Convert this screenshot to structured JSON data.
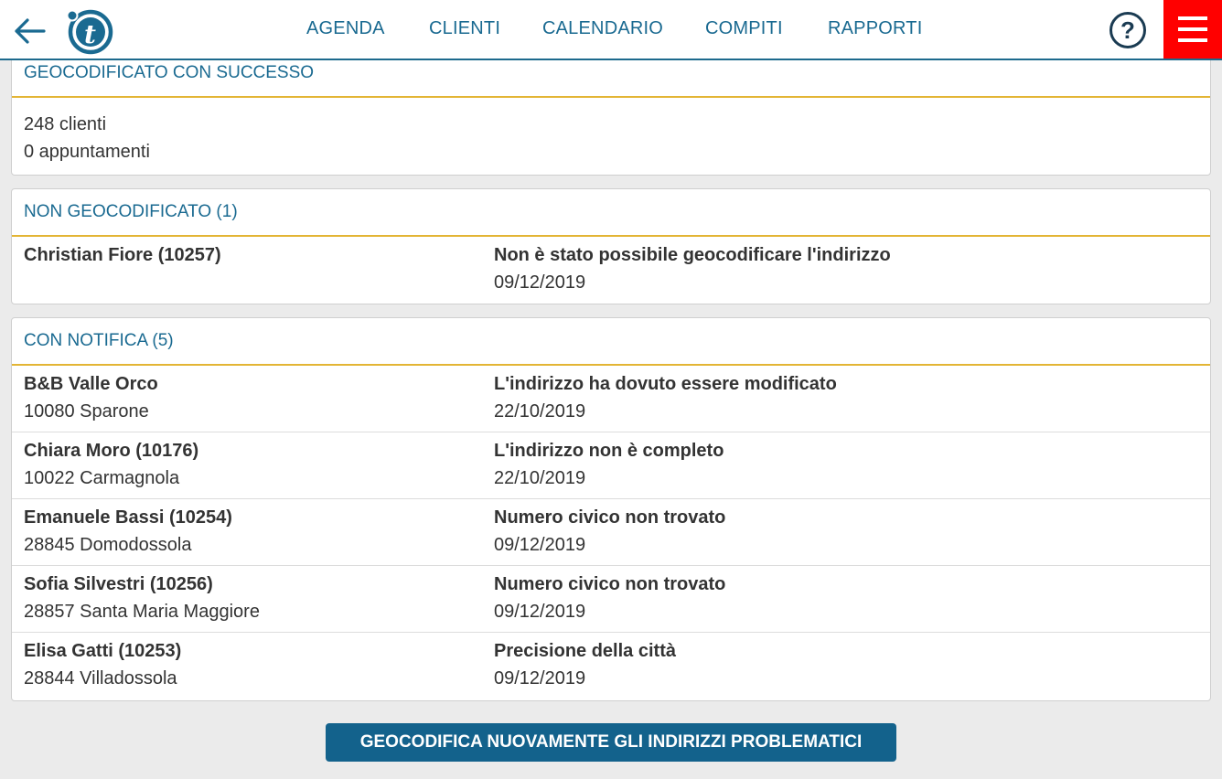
{
  "header": {
    "nav": [
      {
        "label": "AGENDA"
      },
      {
        "label": "CLIENTI"
      },
      {
        "label": "CALENDARIO"
      },
      {
        "label": "COMPITI"
      },
      {
        "label": "RAPPORTI"
      }
    ],
    "help_label": "?",
    "icons": {
      "back": "arrow-left-icon",
      "logo": "t-logo",
      "help": "question-mark-icon",
      "menu": "hamburger-menu-icon"
    }
  },
  "colors": {
    "accent": "#1a6a91",
    "menu_bg": "#ff0000",
    "divider": "#e3b535",
    "button": "#13628c"
  },
  "success": {
    "title": "GEOCODIFICATO CON SUCCESSO",
    "lines": [
      "248 clienti",
      "0 appuntamenti"
    ]
  },
  "failed": {
    "title": "NON GEOCODIFICATO (1)",
    "rows": [
      {
        "name": "Christian Fiore (10257)",
        "sub": "",
        "reason": "Non è stato possibile geocodificare l'indirizzo",
        "date": "09/12/2019"
      }
    ]
  },
  "warnings": {
    "title": "CON NOTIFICA (5)",
    "rows": [
      {
        "name": "B&B Valle Orco",
        "sub": "10080 Sparone",
        "reason": "L'indirizzo ha dovuto essere modificato",
        "date": "22/10/2019"
      },
      {
        "name": "Chiara Moro (10176)",
        "sub": "10022 Carmagnola",
        "reason": "L'indirizzo non è completo",
        "date": "22/10/2019"
      },
      {
        "name": "Emanuele Bassi (10254)",
        "sub": "28845 Domodossola",
        "reason": "Numero civico non trovato",
        "date": "09/12/2019"
      },
      {
        "name": "Sofia Silvestri (10256)",
        "sub": "28857 Santa Maria Maggiore",
        "reason": "Numero civico non trovato",
        "date": "09/12/2019"
      },
      {
        "name": "Elisa Gatti (10253)",
        "sub": "28844 Villadossola",
        "reason": "Precisione della città",
        "date": "09/12/2019"
      }
    ]
  },
  "action": {
    "label": "GEOCODIFICA NUOVAMENTE GLI INDIRIZZI PROBLEMATICI"
  }
}
